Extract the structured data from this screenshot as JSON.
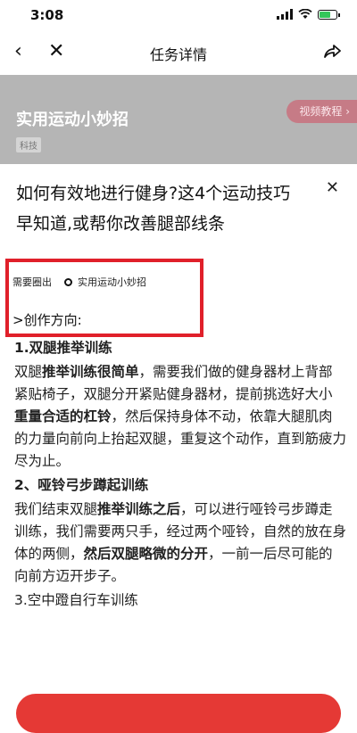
{
  "status_bar": {
    "time": "3:08"
  },
  "nav": {
    "back_icon": "‹",
    "close_icon": "✕",
    "title": "任务详情"
  },
  "banner": {
    "title": "实用运动小妙招",
    "tag": "科技",
    "tutorial_label": "视频教程 ›"
  },
  "task": {
    "title": "如何有效地进行健身?这4个运动技巧早知道,或帮你改善腿部线条",
    "close_icon": "✕",
    "requirement_label": "需要圈出",
    "requirement_value": "实用运动小妙招",
    "direction_label": ">创作方向:"
  },
  "content": {
    "h1": "1.双腿推举训练",
    "p1_a": "双腿",
    "p1_b": "推举训练很简单",
    "p1_c": "，需要我们做的健身器材上背部紧贴椅子，双腿分开紧贴健身器材，提前挑选好大小",
    "p1_d": "重量合适的杠铃",
    "p1_e": "，然后保持身体不动，依靠大腿肌肉的力量向前向上抬起双腿，重复这个动作，直到筋疲力尽为止。",
    "h2": "2、哑铃弓步蹲起训练",
    "p2_a": "我们结束双腿",
    "p2_b": "推举训练之后",
    "p2_c": "，可以进行哑铃弓步蹲走训练，我们需要两只手，经过两个哑铃，自然的放在身体的两侧，",
    "p2_d": "然后双腿略微的分开",
    "p2_e": "，一前一后尽可能的向前方迈开步子。",
    "h3": "3.空中蹬自行车训练"
  },
  "colors": {
    "highlight": "#e0202a",
    "button": "#e53935",
    "tutorial": "#c67b86"
  }
}
